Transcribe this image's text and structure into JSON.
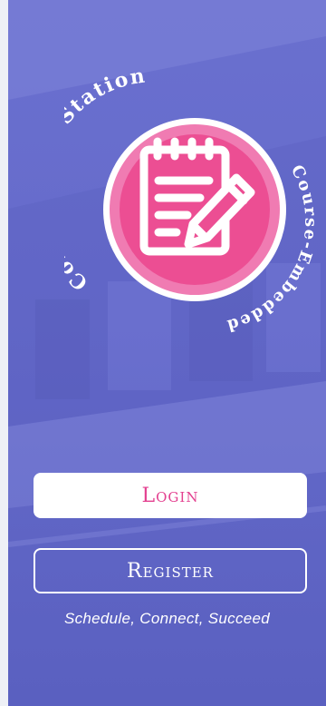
{
  "logo": {
    "arc_top": "Consultation Station",
    "arc_right": "Course-Embedded",
    "icon": "notepad-pencil-icon",
    "colors": {
      "outer_ring": "#f07bb2",
      "inner_circle": "#ec4e93",
      "rim": "#ffffff"
    }
  },
  "buttons": {
    "login_label": "Login",
    "register_label": "Register"
  },
  "tagline": "Schedule, Connect, Succeed",
  "colors": {
    "background": "#666bcb",
    "accent": "#e33f8f",
    "text": "#ffffff"
  }
}
